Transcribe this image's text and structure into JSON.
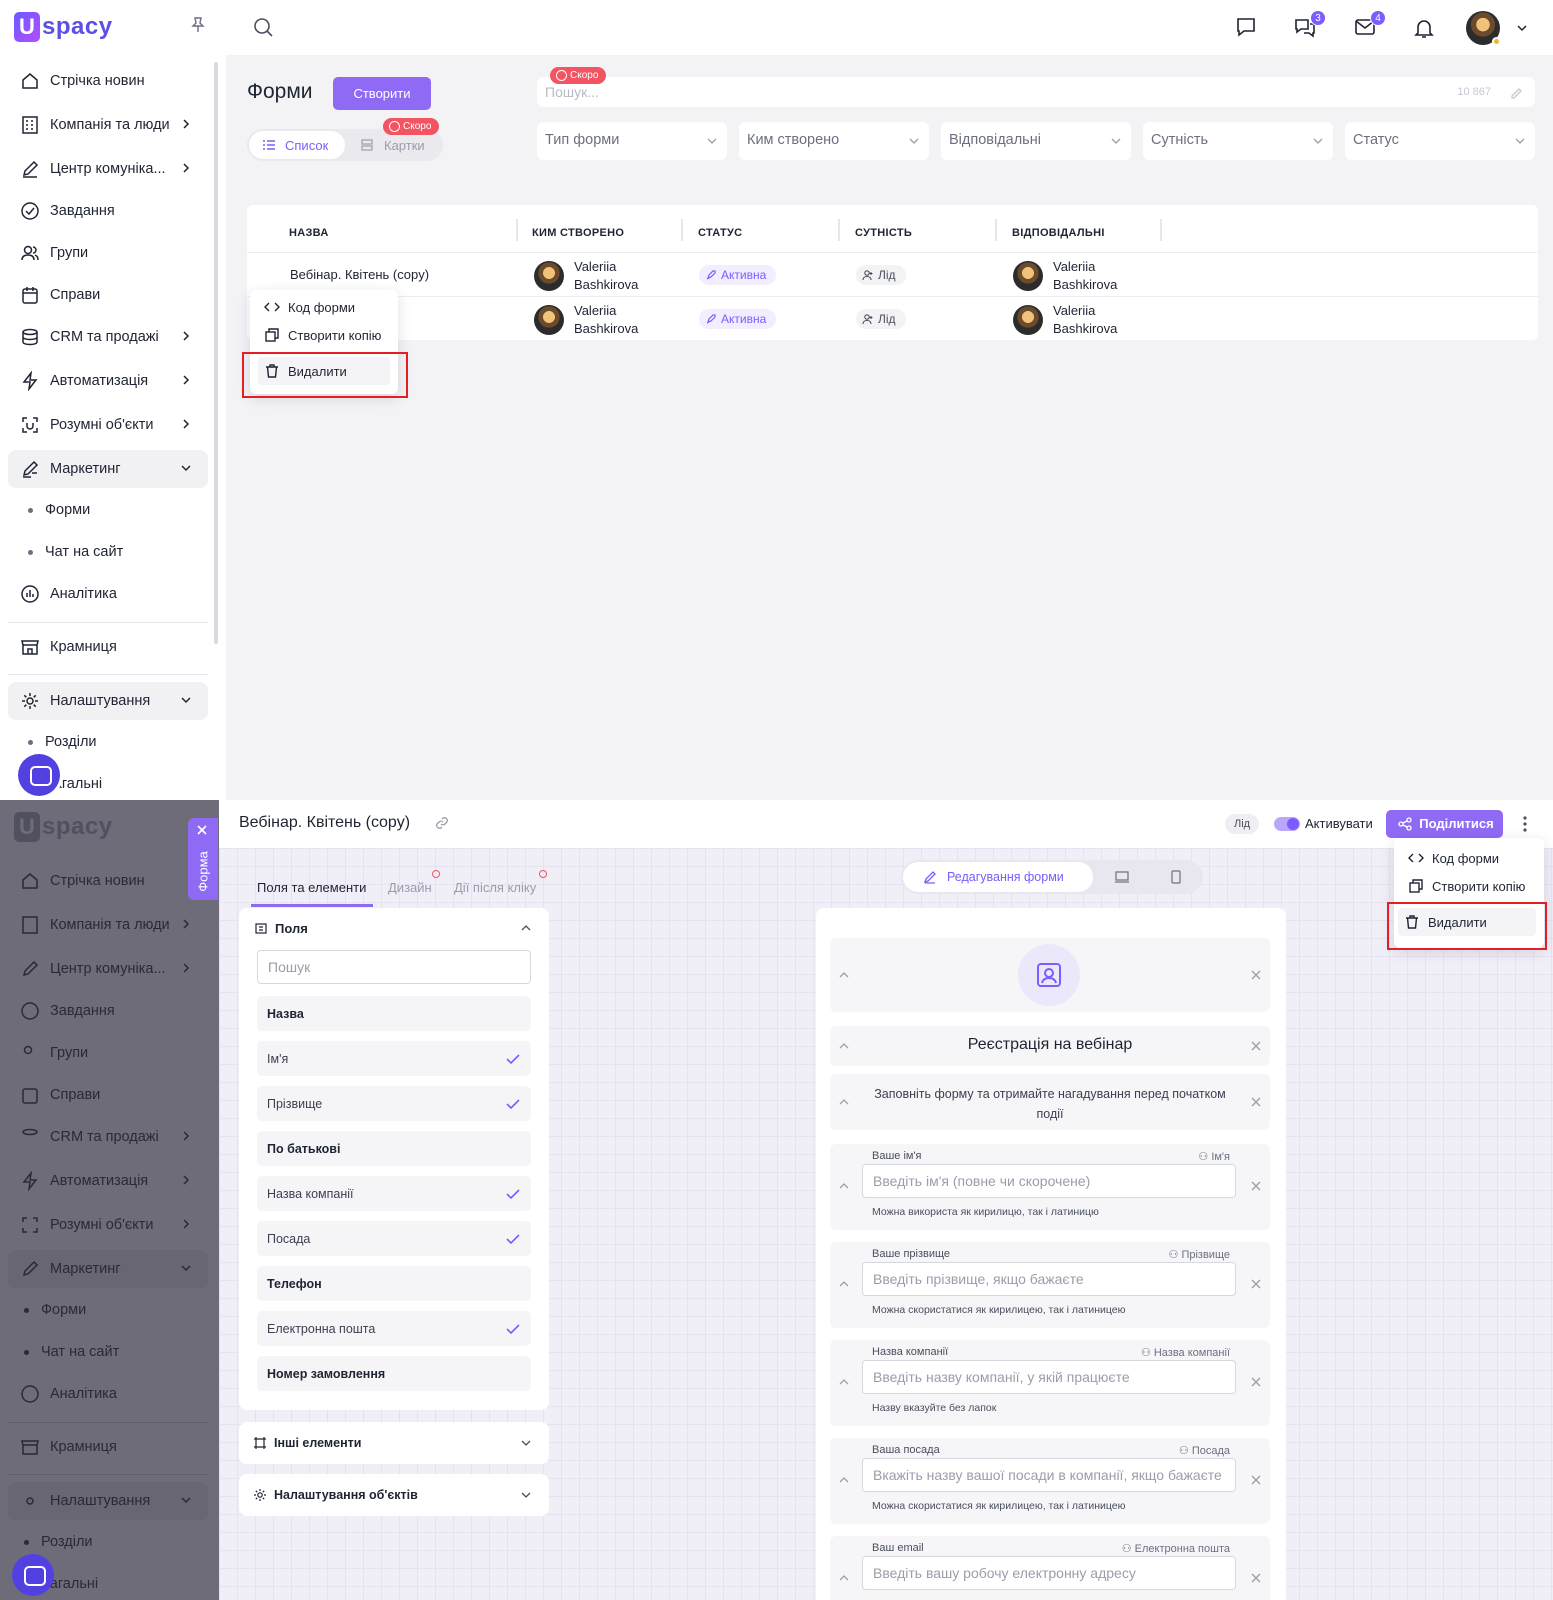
{
  "brand": {
    "logo_letter": "U",
    "logo_text": "spacy",
    "accent": "#8f6bf5"
  },
  "sidebar": {
    "items": [
      {
        "label": "Стрічка новин",
        "icon": "home-icon"
      },
      {
        "label": "Компанія та люди",
        "icon": "building-icon"
      },
      {
        "label": "Центр комуніка...",
        "icon": "edit-icon"
      },
      {
        "label": "Завдання",
        "icon": "check-circle-icon"
      },
      {
        "label": "Групи",
        "icon": "users-icon"
      },
      {
        "label": "Справи",
        "icon": "calendar-icon"
      },
      {
        "label": "CRM та продажі",
        "icon": "database-icon"
      },
      {
        "label": "Автоматизація",
        "icon": "lightning-icon"
      },
      {
        "label": "Розумні об'єкти",
        "icon": "scan-icon"
      },
      {
        "label": "Маркетинг",
        "icon": "marketing-icon"
      },
      {
        "label": "Аналітика",
        "icon": "chart-icon"
      },
      {
        "label": "Крамниця",
        "icon": "store-icon"
      },
      {
        "label": "Налаштування",
        "icon": "gear-icon"
      }
    ],
    "marketing_sub": [
      "Форми",
      "Чат на сайт"
    ],
    "settings_sub": [
      "Розділи",
      "Загальні"
    ]
  },
  "header": {
    "badges": {
      "chats": "3",
      "mail": "4"
    }
  },
  "forms_page": {
    "title": "Форми",
    "create_label": "Створити",
    "soon_label": "Скоро",
    "view_list": "Список",
    "view_cards": "Картки",
    "search_placeholder": "Пошук...",
    "count": "10 867",
    "filters": [
      "Тип форми",
      "Ким створено",
      "Відповідальні",
      "Сутність",
      "Статус"
    ],
    "columns": [
      "НАЗВА",
      "КИМ СТВОРЕНО",
      "СТАТУС",
      "СУТНІСТЬ",
      "ВІДПОВІДАЛЬНІ"
    ],
    "rows": [
      {
        "name": "Вебінар. Квітень (copy)",
        "creator_first": "Valeriia",
        "creator_last": "Bashkirova",
        "status": "Активна",
        "entity": "Лід",
        "resp_first": "Valeriia",
        "resp_last": "Bashkirova"
      },
      {
        "name": "",
        "creator_first": "Valeriia",
        "creator_last": "Bashkirova",
        "status": "Активна",
        "entity": "Лід",
        "resp_first": "Valeriia",
        "resp_last": "Bashkirova"
      }
    ]
  },
  "context_menu": {
    "code": "Код форми",
    "copy": "Створити копію",
    "delete": "Видалити"
  },
  "editor": {
    "vertical_tab": "Форма",
    "title": "Вебінар. Квітень (copy)",
    "entity": "Лід",
    "activate": "Активувати",
    "share": "Поділитися",
    "tabs": [
      "Поля та елементи",
      "Дизайн",
      "Дії після кліку"
    ],
    "mode": "Редагування форми",
    "fields_section": "Поля",
    "fields_search": "Пошук",
    "fields": [
      {
        "label": "Назва",
        "checked": false
      },
      {
        "label": "Ім'я",
        "checked": true
      },
      {
        "label": "Прізвище",
        "checked": true
      },
      {
        "label": "По батькові",
        "checked": false
      },
      {
        "label": "Назва компанії",
        "checked": true
      },
      {
        "label": "Посада",
        "checked": true
      },
      {
        "label": "Телефон",
        "checked": false
      },
      {
        "label": "Електронна пошта",
        "checked": true
      },
      {
        "label": "Номер замовлення",
        "checked": false
      }
    ],
    "other_elements": "Інші елементи",
    "object_settings": "Налаштування об'єктів",
    "form_title": "Реєстрація на вебінар",
    "form_subtitle_1": "Заповніть форму та отримайте нагадування перед початком",
    "form_subtitle_2": "події",
    "inputs": [
      {
        "label": "Ваше ім'я",
        "map": "Ім'я",
        "placeholder": "Введіть ім'я (повне чи скорочене)",
        "hint": "Можна використа як кирилицю, так і латиницю"
      },
      {
        "label": "Ваше прізвище",
        "map": "Прізвище",
        "placeholder": "Введіть прізвище,  якщо бажаєте",
        "hint": "Можна скористатися як кирилицею, так і латиницею"
      },
      {
        "label": "Назва компанії",
        "map": "Назва компанії",
        "placeholder": "Введіть назву компанії, у якій працюєте",
        "hint": "Назву вказуйте без лапок"
      },
      {
        "label": "Ваша посада",
        "map": "Посада",
        "placeholder": "Вкажіть назву вашої посади в компанії, якщо бажаєте",
        "hint": "Можна скористатися як кирилицею, так і латиницею"
      },
      {
        "label": "Ваш email",
        "map": "Електронна пошта",
        "placeholder": "Введіть вашу робочу електронну адресу",
        "hint": ""
      }
    ]
  }
}
